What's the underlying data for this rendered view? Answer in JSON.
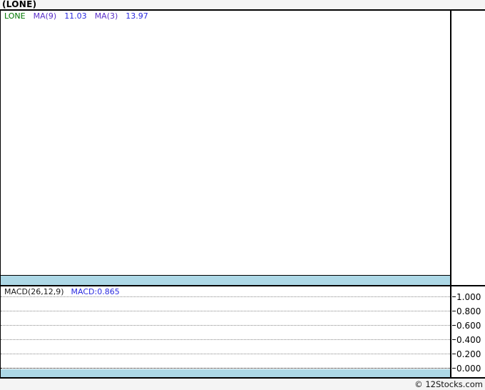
{
  "header": {
    "title": "(LONE)"
  },
  "price_panel": {
    "symbol": "LONE",
    "indicators": [
      {
        "label": "MA(9)",
        "value": "11.03"
      },
      {
        "label": "MA(3)",
        "value": "13.97"
      }
    ]
  },
  "macd_panel": {
    "label": "MACD(26,12,9)",
    "value": "MACD:0.865",
    "ytick_labels": [
      "1.000",
      "0.800",
      "0.600",
      "0.400",
      "0.200",
      "0.000"
    ]
  },
  "footer": {
    "credit": "© 12Stocks.com"
  },
  "colors": {
    "separator_band": "#ADD8E6",
    "header_bg": "#f4f4f4",
    "symbol_text": "#007700",
    "ma_label_text": "#5a2fc8",
    "ma_value_text": "#2a2ae0",
    "macd_value_text": "#2a2ae0",
    "grid_dotted": "#8a8a8a"
  },
  "chart_data": [
    {
      "type": "line",
      "title": "(LONE) price pane",
      "series": [
        {
          "name": "MA(9)",
          "last_value": 11.03,
          "values": []
        },
        {
          "name": "MA(3)",
          "last_value": 13.97,
          "values": []
        }
      ],
      "note": "price pane is rendered empty - no candles or lines visible",
      "grid": "off",
      "axis_position": "right"
    },
    {
      "type": "line",
      "title": "MACD(26,12,9)",
      "series": [
        {
          "name": "MACD",
          "last_value": 0.865,
          "values": []
        }
      ],
      "yticks": [
        1.0,
        0.8,
        0.6,
        0.4,
        0.2,
        0.0
      ],
      "ytick_labels": [
        "1.000",
        "0.800",
        "0.600",
        "0.400",
        "0.200",
        "0.000"
      ],
      "ylim": [
        -0.12,
        1.1
      ],
      "grid": "horizontal-dotted",
      "zero_line": "dotted-black",
      "axis_position": "right",
      "note": "no MACD curve visibly plotted"
    }
  ]
}
